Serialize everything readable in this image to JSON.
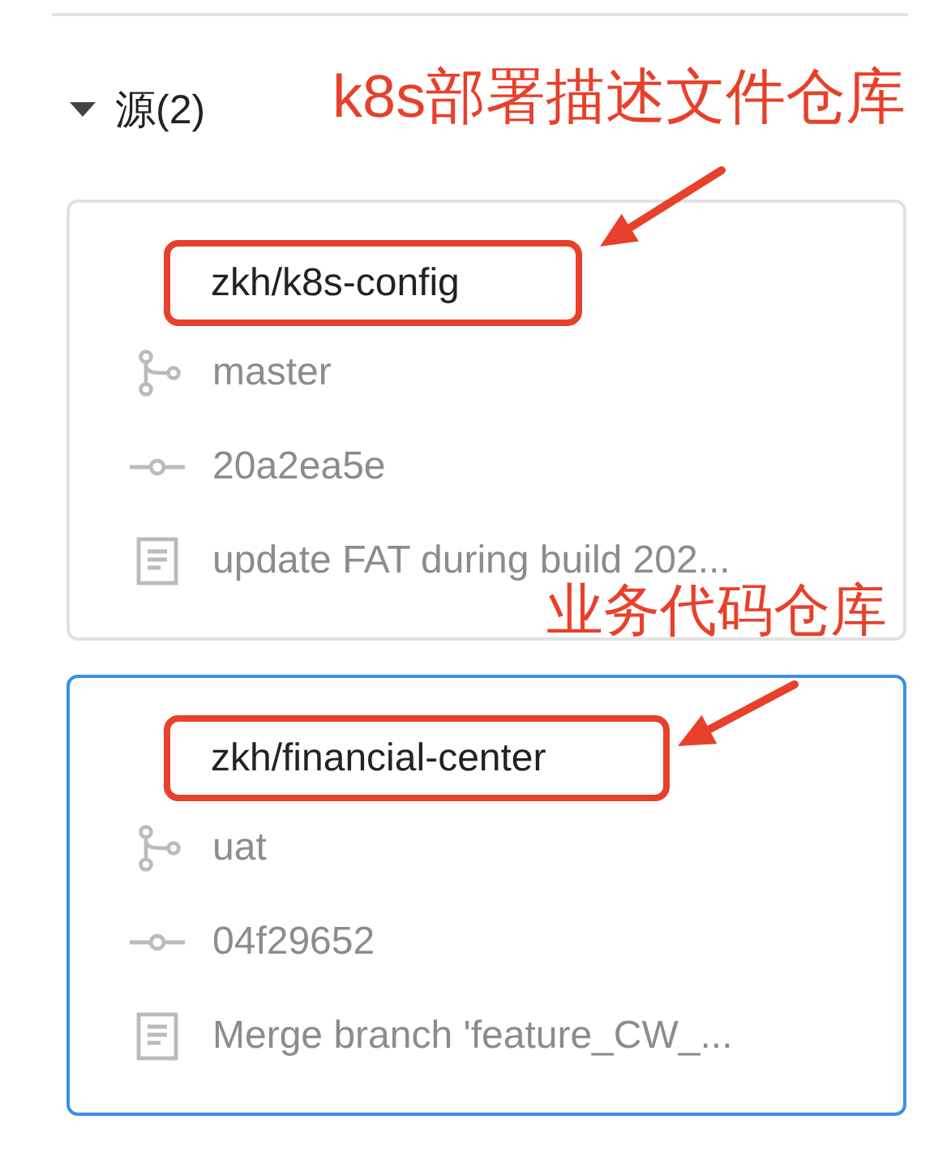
{
  "section": {
    "title": "源(2)",
    "expanded": true
  },
  "sources": [
    {
      "repo": "zkh/k8s-config",
      "branch": "master",
      "commit": "20a2ea5e",
      "message": "update FAT during build 202...",
      "selected": false,
      "highlighted": true
    },
    {
      "repo": "zkh/financial-center",
      "branch": "uat",
      "commit": "04f29652",
      "message": "Merge branch 'feature_CW_...",
      "selected": true,
      "highlighted": true
    }
  ],
  "annotations": [
    {
      "text": "k8s部署描述文件仓库"
    },
    {
      "text": "业务代码仓库"
    }
  ]
}
